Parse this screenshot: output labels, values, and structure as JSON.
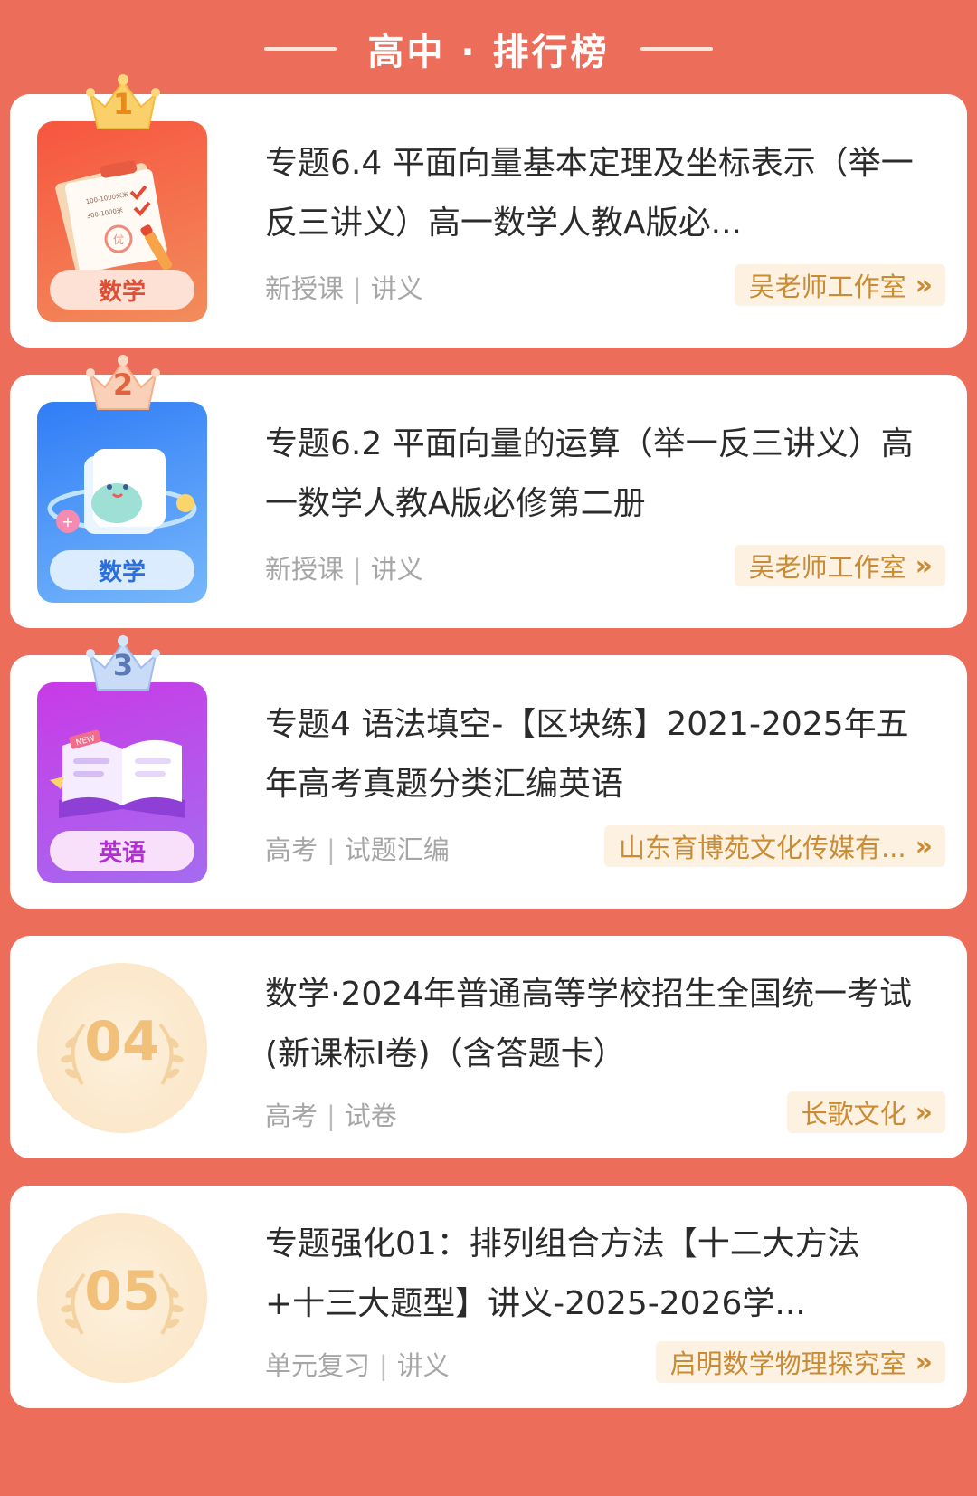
{
  "header": {
    "title": "高中 · 排行榜"
  },
  "items": [
    {
      "rank_label": "1",
      "subject": "数学",
      "title": "专题6.4 平面向量基本定理及坐标表示（举一反三讲义）高一数学人教A版必...",
      "tag1": "新授课",
      "tag2": "讲义",
      "author": "吴老师工作室"
    },
    {
      "rank_label": "2",
      "subject": "数学",
      "title": "专题6.2 平面向量的运算（举一反三讲义）高一数学人教A版必修第二册",
      "tag1": "新授课",
      "tag2": "讲义",
      "author": "吴老师工作室"
    },
    {
      "rank_label": "3",
      "subject": "英语",
      "title": "专题4 语法填空-【区块练】2021-2025年五年高考真题分类汇编英语",
      "tag1": "高考",
      "tag2": "试题汇编",
      "author": "山东育博苑文化传媒有..."
    },
    {
      "rank_label": "04",
      "subject": "",
      "title": "数学·2024年普通高等学校招生全国统一考试(新课标I卷)（含答题卡）",
      "tag1": "高考",
      "tag2": "试卷",
      "author": "长歌文化"
    },
    {
      "rank_label": "05",
      "subject": "",
      "title": "专题强化01：排列组合方法【十二大方法+十三大题型】讲义-2025-2026学...",
      "tag1": "单元复习",
      "tag2": "讲义",
      "author": "启明数学物理探究室"
    }
  ],
  "separator": "|",
  "chevron": "»",
  "thumb_text": {
    "paper_lines": [
      "100-1000米米",
      "300-1000米"
    ],
    "grade_stamp": "优",
    "book_badge": "NEW"
  },
  "colors": {
    "background": "#ec6d59",
    "author_text": "#c98b34",
    "author_bg": "#fdf1e1",
    "rank_gold": "#f1c17c"
  },
  "icons": {
    "crown": "crown-icon",
    "clipboard": "clipboard-icon",
    "notepad": "notepad-icon",
    "book": "open-book-icon",
    "laurel": "laurel-icon",
    "chevron": "double-chevron-right-icon"
  }
}
